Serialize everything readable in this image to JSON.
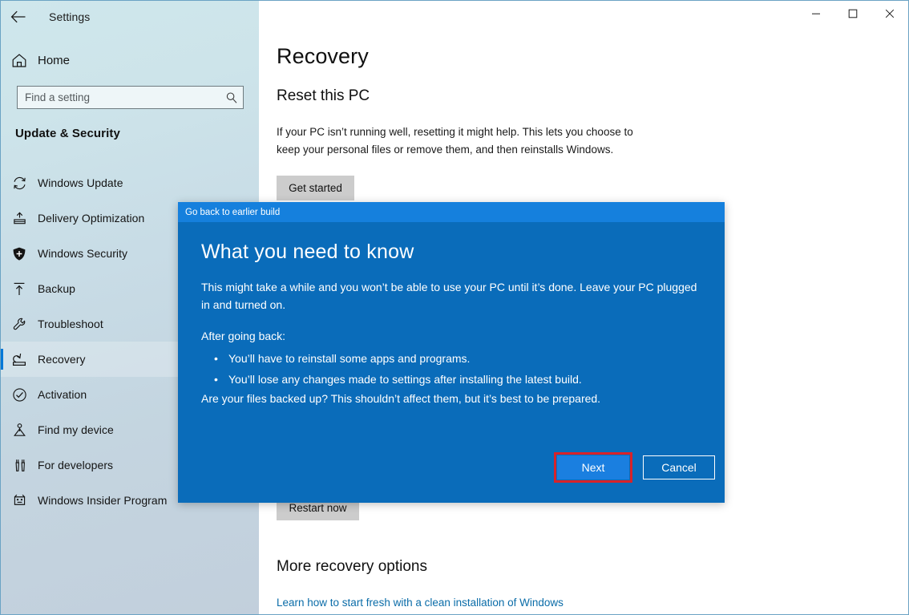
{
  "window": {
    "title": "Settings",
    "back_icon": "back-arrow-icon",
    "controls": [
      {
        "name": "minimize-button",
        "glyph": "─"
      },
      {
        "name": "maximize-button",
        "glyph": "☐"
      },
      {
        "name": "close-button",
        "glyph": "✕"
      }
    ]
  },
  "sidebar": {
    "home_label": "Home",
    "home_icon": "home-icon",
    "search": {
      "placeholder": "Find a setting",
      "value": "",
      "icon": "search-icon"
    },
    "section_heading": "Update & Security",
    "items": [
      {
        "label": "Windows Update",
        "icon": "refresh-icon",
        "selected": false
      },
      {
        "label": "Delivery Optimization",
        "icon": "delivery-icon",
        "selected": false
      },
      {
        "label": "Windows Security",
        "icon": "shield-icon",
        "selected": false
      },
      {
        "label": "Backup",
        "icon": "upload-arrow-icon",
        "selected": false
      },
      {
        "label": "Troubleshoot",
        "icon": "wrench-icon",
        "selected": false
      },
      {
        "label": "Recovery",
        "icon": "recovery-icon",
        "selected": true
      },
      {
        "label": "Activation",
        "icon": "check-circle-icon",
        "selected": false
      },
      {
        "label": "Find my device",
        "icon": "locate-person-icon",
        "selected": false
      },
      {
        "label": "For developers",
        "icon": "tools-icon",
        "selected": false
      },
      {
        "label": "Windows Insider Program",
        "icon": "insider-bug-icon",
        "selected": false
      }
    ]
  },
  "main": {
    "page_title": "Recovery",
    "reset": {
      "heading": "Reset this PC",
      "description": "If your PC isn’t running well, resetting it might help. This lets you choose to keep your personal files or remove them, and then reinstalls Windows.",
      "button_label": "Get started"
    },
    "advanced": {
      "restart_button_label": "Restart now"
    },
    "more": {
      "heading": "More recovery options",
      "link_label": "Learn how to start fresh with a clean installation of Windows"
    }
  },
  "dialog": {
    "titlebar_label": "Go back to earlier build",
    "heading": "What you need to know",
    "intro": "This might take a while and you won’t be able to use your PC until it’s done. Leave your PC plugged in and turned on.",
    "after_label": "After going back:",
    "bullets": [
      "You’ll have to reinstall some apps and programs.",
      "You’ll lose any changes made to settings after installing the latest build."
    ],
    "closing": "Are your files backed up? This shouldn’t affect them, but it’s best to be prepared.",
    "next_label": "Next",
    "cancel_label": "Cancel",
    "highlight_color": "#d8232a",
    "accent_color": "#0a6cba"
  }
}
